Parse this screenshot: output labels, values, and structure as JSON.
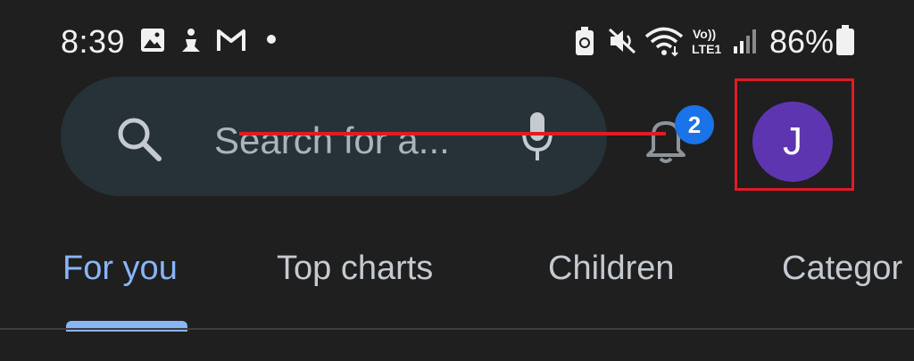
{
  "status_bar": {
    "time": "8:39",
    "battery_percent": "86%",
    "icons": [
      "gallery-icon",
      "yoga-icon",
      "gmail-icon",
      "dot-icon",
      "battery-saver-icon",
      "mute-icon",
      "wifi-icon",
      "volte-icon",
      "signal-icon",
      "battery-icon"
    ]
  },
  "search": {
    "placeholder": "Search for a..."
  },
  "notifications": {
    "count": "2"
  },
  "account": {
    "initial": "J",
    "avatar_color": "#5e35b1"
  },
  "tabs": [
    {
      "label": "For you",
      "active": true
    },
    {
      "label": "Top charts",
      "active": false
    },
    {
      "label": "Children",
      "active": false
    },
    {
      "label": "Categor",
      "active": false
    }
  ],
  "colors": {
    "background": "#1f1f1f",
    "search_bg": "#263238",
    "accent": "#8ab4f8",
    "highlight": "#e01b24",
    "badge": "#1a73e8"
  }
}
